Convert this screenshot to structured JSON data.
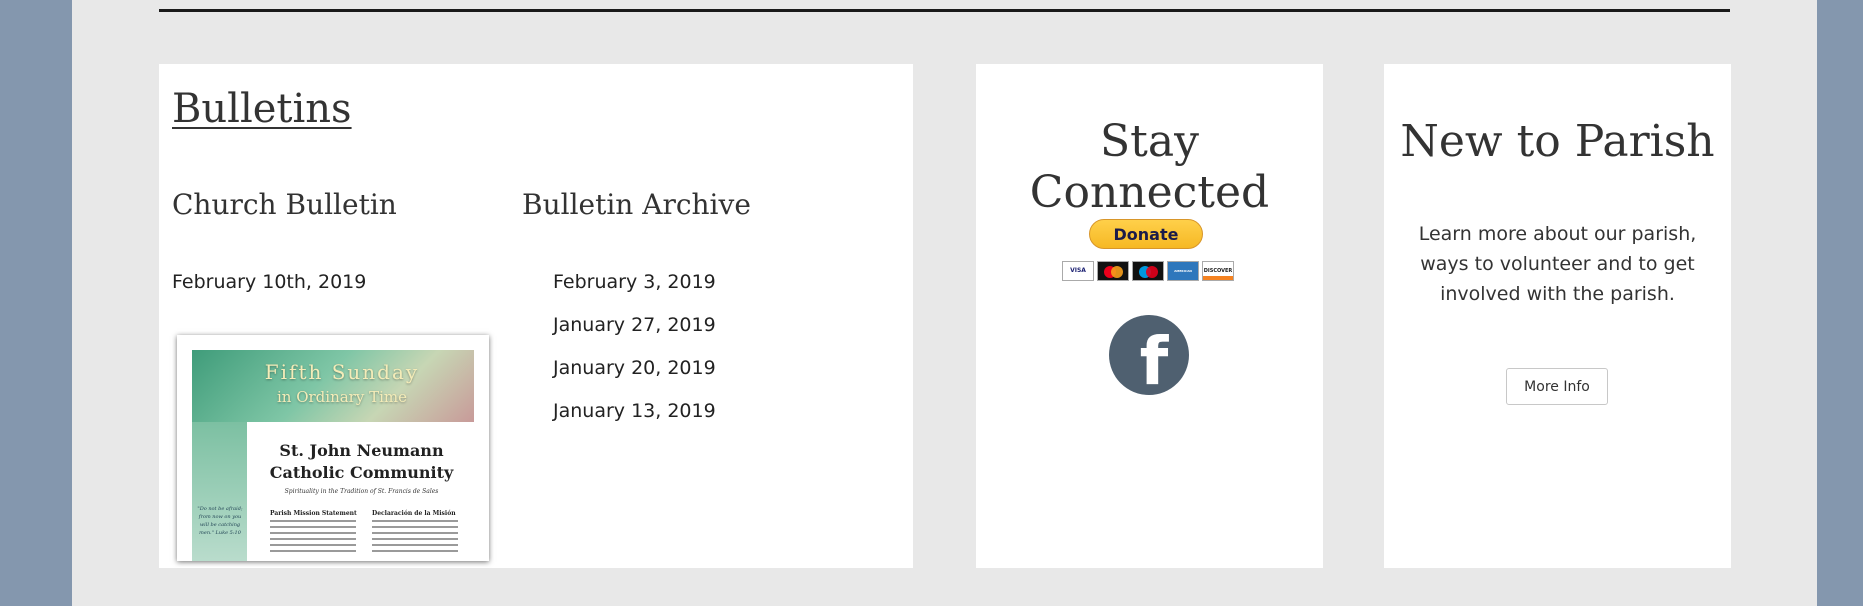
{
  "bulletins": {
    "title": "Bulletins",
    "current_heading": "Church Bulletin",
    "current_date": "February 10th, 2019",
    "archive_heading": "Bulletin Archive",
    "archive": [
      "February 3, 2019",
      "January 27, 2019",
      "January 20, 2019",
      "January 13, 2019"
    ],
    "thumbnail": {
      "banner_title": "Fifth Sunday",
      "banner_sub": "in Ordinary Time",
      "parish_line1": "St. John Neumann",
      "parish_line2": "Catholic Community",
      "tagline": "Spirituality in the Tradition of St. Francis de Sales",
      "quote": "\"Do not be afraid; from now on you will be catching men.\" Luke 5:10",
      "heading_en": "Parish Mission Statement",
      "heading_es": "Declaración de la Misión"
    }
  },
  "connect": {
    "title": "Stay Connected",
    "donate_label": "Donate",
    "card_icons": [
      "visa-icon",
      "mastercard-icon",
      "maestro-icon",
      "amex-icon",
      "discover-icon"
    ],
    "visa_text": "VISA",
    "amex_text": "AMERICAN EXPRESS",
    "discover_text": "DISCOVER",
    "facebook_glyph": "f"
  },
  "new_parish": {
    "title": "New to Parish",
    "text": "Learn more about our parish, ways to volunteer and to get involved with the parish.",
    "button_label": "More Info"
  },
  "colors": {
    "outer_background": "#8497ae",
    "page_background": "#e8e8e8",
    "card_background": "#ffffff",
    "heading_text": "#333333",
    "paypal_yellow": "#ffc439",
    "facebook_circle": "#4f6070"
  }
}
